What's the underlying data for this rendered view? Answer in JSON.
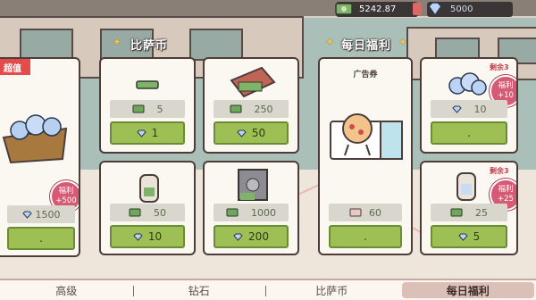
{
  "currency": {
    "cash": "5242.87",
    "gems": "5000"
  },
  "sections": {
    "pizza_coins": "比萨币",
    "daily_welfare": "每日福利"
  },
  "featured": {
    "tag": "超值",
    "bonus_label": "福利",
    "bonus_value": "+500",
    "price": "1500",
    "button": "."
  },
  "pizza_cards": [
    {
      "amount": "5",
      "cost": "1"
    },
    {
      "amount": "250",
      "cost": "50"
    },
    {
      "amount": "50",
      "cost": "10"
    },
    {
      "amount": "1000",
      "cost": "200"
    }
  ],
  "ad_card": {
    "title": "广告券",
    "amount": "60",
    "button": "."
  },
  "daily_cards": [
    {
      "remain": "剩余3",
      "bonus_label": "福利",
      "bonus_value": "+10",
      "amount": "10",
      "button": "."
    },
    {
      "remain": "剩余3",
      "bonus_label": "福利",
      "bonus_value": "+25",
      "amount": "25",
      "cost": "5"
    }
  ],
  "tabs": [
    "高级",
    "钻石",
    "比萨币",
    "每日福利"
  ],
  "active_tab": "每日福利",
  "colors": {
    "accent_green": "#9dbf54",
    "badge_pink": "#d65a73",
    "tag_red": "#e54b4b"
  }
}
